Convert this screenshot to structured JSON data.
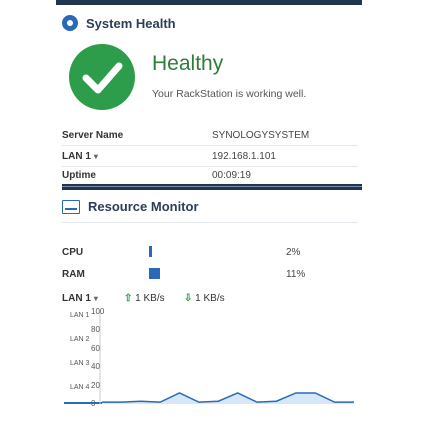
{
  "system_health": {
    "title": "System Health",
    "status": "Healthy",
    "message": "Your RackStation is working well.",
    "rows": [
      {
        "label": "Server Name",
        "value": "SYNOLOGYSYSTEM",
        "has_dropdown": false
      },
      {
        "label": "LAN 1",
        "value": "192.168.1.101",
        "has_dropdown": true
      },
      {
        "label": "Uptime",
        "value": "00:09:19",
        "has_dropdown": false
      }
    ]
  },
  "resource_monitor": {
    "title": "Resource Monitor",
    "cpu": {
      "label": "CPU",
      "percent_text": "2%",
      "percent": 2
    },
    "ram": {
      "label": "RAM",
      "percent_text": "11%",
      "percent": 11
    },
    "lan": {
      "label": "LAN 1",
      "upload": "1 KB/s",
      "download": "1 KB/s"
    },
    "lan_options": [
      "LAN 1",
      "LAN 2",
      "LAN 3",
      "LAN 4"
    ]
  },
  "chart_data": {
    "type": "line",
    "title": "",
    "xlabel": "",
    "ylabel": "",
    "ylim": [
      0,
      100
    ],
    "yticks": [
      100,
      80,
      60,
      40,
      20,
      0
    ],
    "series": [
      {
        "values": [
          2,
          2,
          3,
          2,
          12,
          2,
          3,
          12,
          2,
          3,
          12,
          12,
          2,
          2
        ]
      }
    ],
    "colors": {
      "line": "#2a69b8",
      "fill": "#5aa0e0"
    }
  },
  "colors": {
    "accent": "#2a69b8",
    "healthy": "#2e9d4b",
    "header_bar": "#1f3550"
  }
}
